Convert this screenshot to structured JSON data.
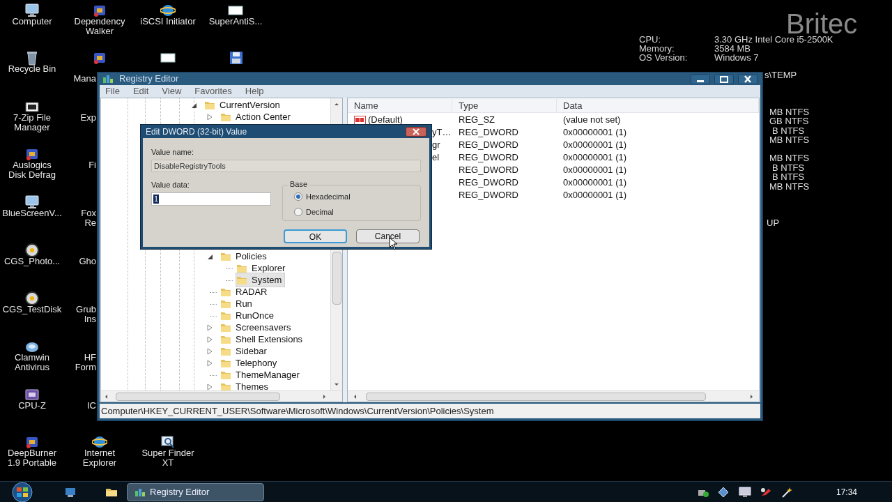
{
  "desktop_icons": [
    {
      "label": "Computer"
    },
    {
      "label": "Recycle Bin"
    },
    {
      "label": "7-Zip File\nManager"
    },
    {
      "label": "Auslogics\nDisk Defrag"
    },
    {
      "label": "BlueScreenV..."
    },
    {
      "label": "CGS_Photo..."
    },
    {
      "label": "CGS_TestDisk"
    },
    {
      "label": "Clamwin\nAntivirus"
    },
    {
      "label": "CPU-Z"
    },
    {
      "label": "DeepBurner\n1.9 Portable"
    },
    {
      "label": "Dependency\nWalker"
    },
    {
      "label": "Mana"
    },
    {
      "label": "Exp"
    },
    {
      "label": "Fi"
    },
    {
      "label": "Fox\nRe"
    },
    {
      "label": "Gho"
    },
    {
      "label": "Grub\nIns"
    },
    {
      "label": "HF\nForm"
    },
    {
      "label": "IC"
    },
    {
      "label": "Internet\nExplorer"
    },
    {
      "label": "iSCSI Initiator"
    },
    {
      "label": "Super Finder\nXT"
    },
    {
      "label": "SuperAntiS..."
    }
  ],
  "system_info": {
    "logo": "Britec",
    "rows": [
      {
        "label": "CPU:",
        "value": "3.30 GHz Intel Core i5-2500K"
      },
      {
        "label": "Memory:",
        "value": "3584 MB"
      },
      {
        "label": "OS Version:",
        "value": "Windows 7"
      }
    ]
  },
  "background_text": [
    "s\\TEMP",
    "MB NTFS",
    "GB NTFS",
    "B NTFS",
    "MB NTFS",
    "MB NTFS",
    "B NTFS",
    "B NTFS",
    "MB NTFS",
    "UP"
  ],
  "registry_editor": {
    "title": "Registry Editor",
    "menu": [
      "File",
      "Edit",
      "View",
      "Favorites",
      "Help"
    ],
    "tree": [
      {
        "label": "CurrentVersion",
        "kind": "expanded",
        "selected": false,
        "children": [
          {
            "label": "Action Center",
            "kind": "collapsed",
            "selected": false
          },
          {
            "label": "Policies",
            "kind": "expanded",
            "selected": false,
            "children": [
              {
                "label": "Explorer",
                "kind": "leaf",
                "selected": false
              },
              {
                "label": "System",
                "kind": "leaf",
                "selected": true
              }
            ]
          },
          {
            "label": "RADAR",
            "kind": "leaf",
            "selected": false
          },
          {
            "label": "Run",
            "kind": "leaf",
            "selected": false
          },
          {
            "label": "RunOnce",
            "kind": "leaf",
            "selected": false
          },
          {
            "label": "Screensavers",
            "kind": "collapsed",
            "selected": false
          },
          {
            "label": "Shell Extensions",
            "kind": "collapsed",
            "selected": false
          },
          {
            "label": "Sidebar",
            "kind": "collapsed",
            "selected": false
          },
          {
            "label": "Telephony",
            "kind": "collapsed",
            "selected": false
          },
          {
            "label": "ThemeManager",
            "kind": "leaf",
            "selected": false
          },
          {
            "label": "Themes",
            "kind": "collapsed",
            "selected": false
          }
        ]
      }
    ],
    "list": {
      "columns": [
        "Name",
        "Type",
        "Data"
      ],
      "rows": [
        {
          "name": "(Default)",
          "kind": "string",
          "type": "REG_SZ",
          "data": "(value not set)"
        },
        {
          "name": "yT…",
          "kind": "dword",
          "type": "REG_DWORD",
          "data": "0x00000001 (1)"
        },
        {
          "name": "gr",
          "kind": "dword",
          "type": "REG_DWORD",
          "data": "0x00000001 (1)"
        },
        {
          "name": "el",
          "kind": "dword",
          "type": "REG_DWORD",
          "data": "0x00000001 (1)"
        },
        {
          "kind": "dword",
          "type": "REG_DWORD",
          "data": "0x00000001 (1)"
        },
        {
          "kind": "dword",
          "type": "REG_DWORD",
          "data": "0x00000001 (1)"
        },
        {
          "kind": "dword",
          "type": "REG_DWORD",
          "data": "0x00000001 (1)"
        }
      ]
    },
    "status_bar": "Computer\\HKEY_CURRENT_USER\\Software\\Microsoft\\Windows\\CurrentVersion\\Policies\\System"
  },
  "dialog": {
    "title": "Edit DWORD (32-bit) Value",
    "value_name_label": "Value name:",
    "value_name": "DisableRegistryTools",
    "value_data_label": "Value data:",
    "value_data": {
      "value": "1",
      "selected": true
    },
    "base_label": "Base",
    "bases": [
      {
        "label": "Hexadecimal",
        "selected": true
      },
      {
        "label": "Decimal",
        "selected": false
      }
    ],
    "buttons": [
      {
        "label": "OK",
        "focused": true
      },
      {
        "label": "Cancel",
        "focused": false
      }
    ]
  },
  "taskbar": {
    "buttons": [
      {
        "label": "Registry Editor",
        "active": true
      }
    ],
    "clock": "17:34"
  }
}
